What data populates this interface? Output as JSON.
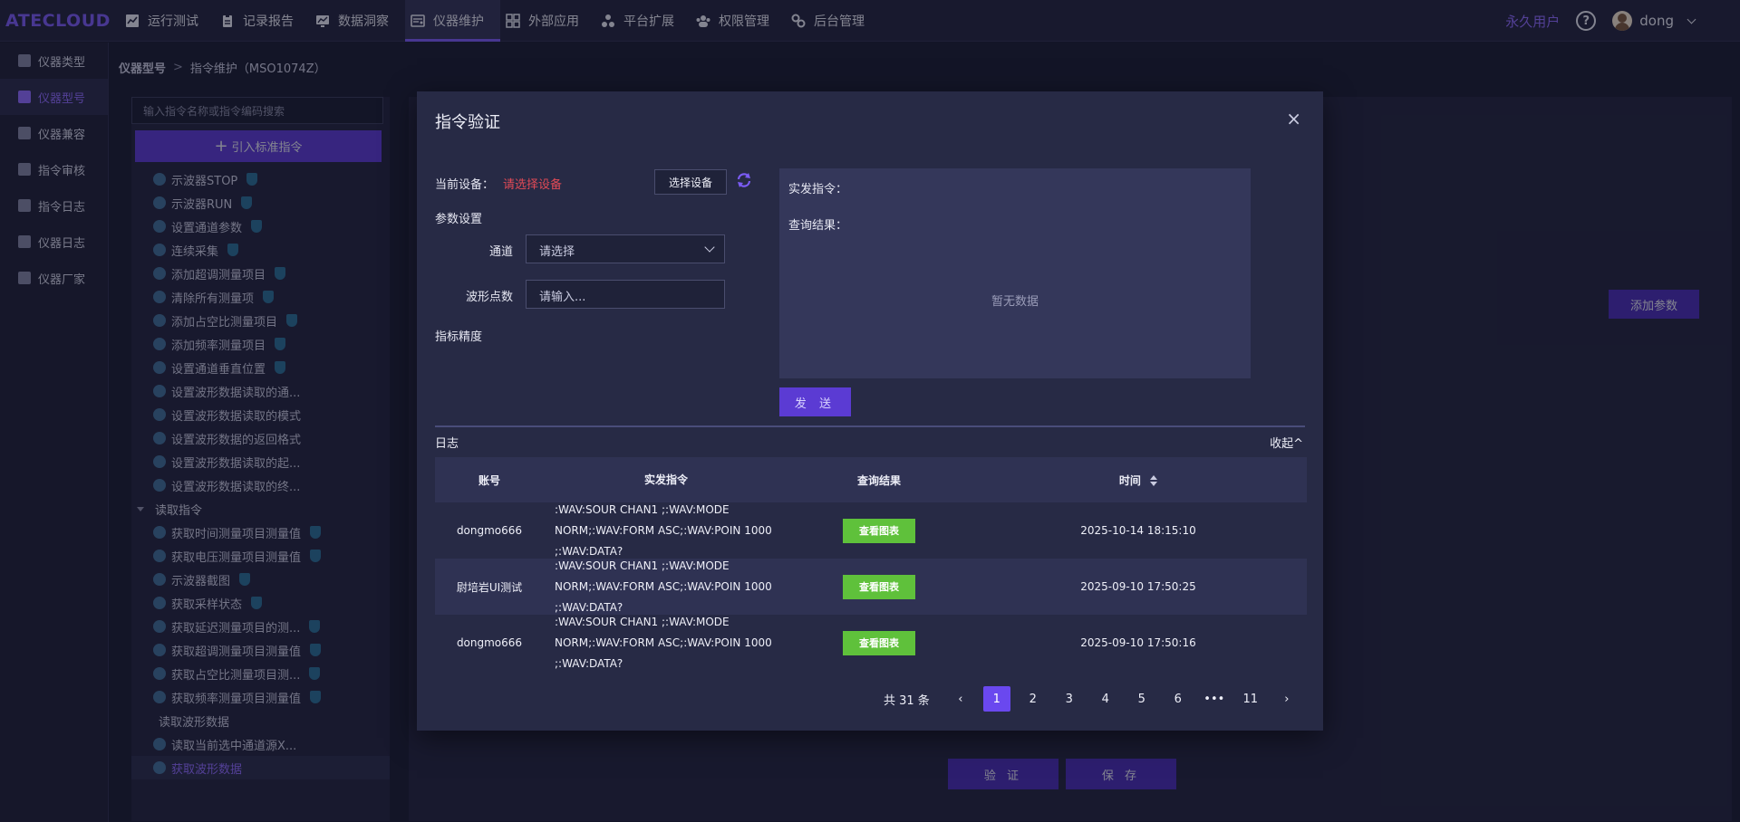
{
  "app": {
    "logo": "ATECLOUD"
  },
  "nav": {
    "items": [
      {
        "label": "运行测试",
        "icon": "chart-line-icon"
      },
      {
        "label": "记录报告",
        "icon": "clipboard-icon"
      },
      {
        "label": "数据洞察",
        "icon": "monitor-chart-icon"
      },
      {
        "label": "仪器维护",
        "icon": "instrument-icon",
        "active": true
      },
      {
        "label": "外部应用",
        "icon": "grid-icon"
      },
      {
        "label": "平台扩展",
        "icon": "nodes-icon"
      },
      {
        "label": "权限管理",
        "icon": "users-icon"
      },
      {
        "label": "后台管理",
        "icon": "gears-icon"
      }
    ],
    "perm_user": "永久用户",
    "help": "?",
    "username": "dong"
  },
  "sidebar": {
    "items": [
      {
        "label": "仪器类型"
      },
      {
        "label": "仪器型号",
        "active": true
      },
      {
        "label": "仪器兼容"
      },
      {
        "label": "指令审核"
      },
      {
        "label": "指令日志"
      },
      {
        "label": "仪器日志"
      },
      {
        "label": "仪器厂家"
      }
    ]
  },
  "breadcrumb": {
    "root": "仪器型号",
    "sep": ">",
    "current": "指令维护（MSO1074Z）"
  },
  "cmd_panel": {
    "search_placeholder": "输入指令名称或指令编码搜索",
    "import_label": "引入标准指令",
    "import_plus": "+",
    "items": [
      {
        "label": "示波器STOP",
        "kind": "cmd"
      },
      {
        "label": "示波器RUN",
        "kind": "cmd"
      },
      {
        "label": "设置通道参数",
        "kind": "cmd"
      },
      {
        "label": "连续采集",
        "kind": "cmd"
      },
      {
        "label": "添加超调测量项目",
        "kind": "cmd"
      },
      {
        "label": "清除所有测量项",
        "kind": "cmd"
      },
      {
        "label": "添加占空比测量项目",
        "kind": "cmd"
      },
      {
        "label": "添加频率测量项目",
        "kind": "cmd"
      },
      {
        "label": "设置通道垂直位置",
        "kind": "cmd"
      },
      {
        "label": "设置波形数据读取的通...",
        "kind": "cmd-noshield"
      },
      {
        "label": "设置波形数据读取的模式",
        "kind": "cmd-noshield"
      },
      {
        "label": "设置波形数据的返回格式",
        "kind": "cmd-noshield"
      },
      {
        "label": "设置波形数据读取的起...",
        "kind": "cmd-noshield"
      },
      {
        "label": "设置波形数据读取的终...",
        "kind": "cmd-noshield"
      },
      {
        "label": "读取指令",
        "kind": "group"
      },
      {
        "label": "获取时间测量项目测量值",
        "kind": "cmd"
      },
      {
        "label": "获取电压测量项目测量值",
        "kind": "cmd"
      },
      {
        "label": "示波器截图",
        "kind": "cmd"
      },
      {
        "label": "获取采样状态",
        "kind": "cmd"
      },
      {
        "label": "获取延迟测量项目的测...",
        "kind": "cmd"
      },
      {
        "label": "获取超调测量项目测量值",
        "kind": "cmd"
      },
      {
        "label": "获取占空比测量项目测...",
        "kind": "cmd"
      },
      {
        "label": "获取频率测量项目测量值",
        "kind": "cmd"
      },
      {
        "label": "读取波形数据",
        "kind": "plain"
      },
      {
        "label": "读取当前选中通道源X...",
        "kind": "cmd-noshield"
      },
      {
        "label": "获取波形数据",
        "kind": "active"
      }
    ]
  },
  "background": {
    "add_param": "添加参数",
    "verify": "验 证",
    "save": "保 存"
  },
  "modal": {
    "title": "指令验证",
    "close": "×",
    "current_device_label": "当前设备：",
    "current_device_value": "请选择设备",
    "select_device_btn": "选择设备",
    "param_settings": "参数设置",
    "channel_label": "通道",
    "channel_placeholder": "请选择",
    "points_label": "波形点数",
    "points_placeholder": "请输入...",
    "precision_label": "指标精度",
    "sent_cmd_label": "实发指令：",
    "query_result_label": "查询结果：",
    "empty": "暂无数据",
    "send_btn": "发 送",
    "log_title": "日志",
    "collapse": "收起^",
    "table": {
      "headers": [
        "账号",
        "实发指令",
        "查询结果",
        "时间"
      ],
      "view_chart": "查看图表",
      "rows": [
        {
          "account": "dongmo666",
          "cmd": ":WAV:SOUR CHAN1 ;:WAV:MODE NORM;:WAV:FORM ASC;:WAV:POIN 1000 ;:WAV:DATA?",
          "time": "2025-10-14 18:15:10"
        },
        {
          "account": "尉培岩UI测试",
          "cmd": ":WAV:SOUR CHAN1 ;:WAV:MODE NORM;:WAV:FORM ASC;:WAV:POIN 1000 ;:WAV:DATA?",
          "time": "2025-09-10 17:50:25"
        },
        {
          "account": "dongmo666",
          "cmd": ":WAV:SOUR CHAN1 ;:WAV:MODE NORM;:WAV:FORM ASC;:WAV:POIN 1000 ;:WAV:DATA?",
          "time": "2025-09-10 17:50:16"
        }
      ]
    },
    "pager": {
      "total": "共 31 条",
      "prev": "‹",
      "next": "›",
      "pages": [
        "1",
        "2",
        "3",
        "4",
        "5",
        "6",
        "•••",
        "11"
      ],
      "current": "1"
    }
  }
}
